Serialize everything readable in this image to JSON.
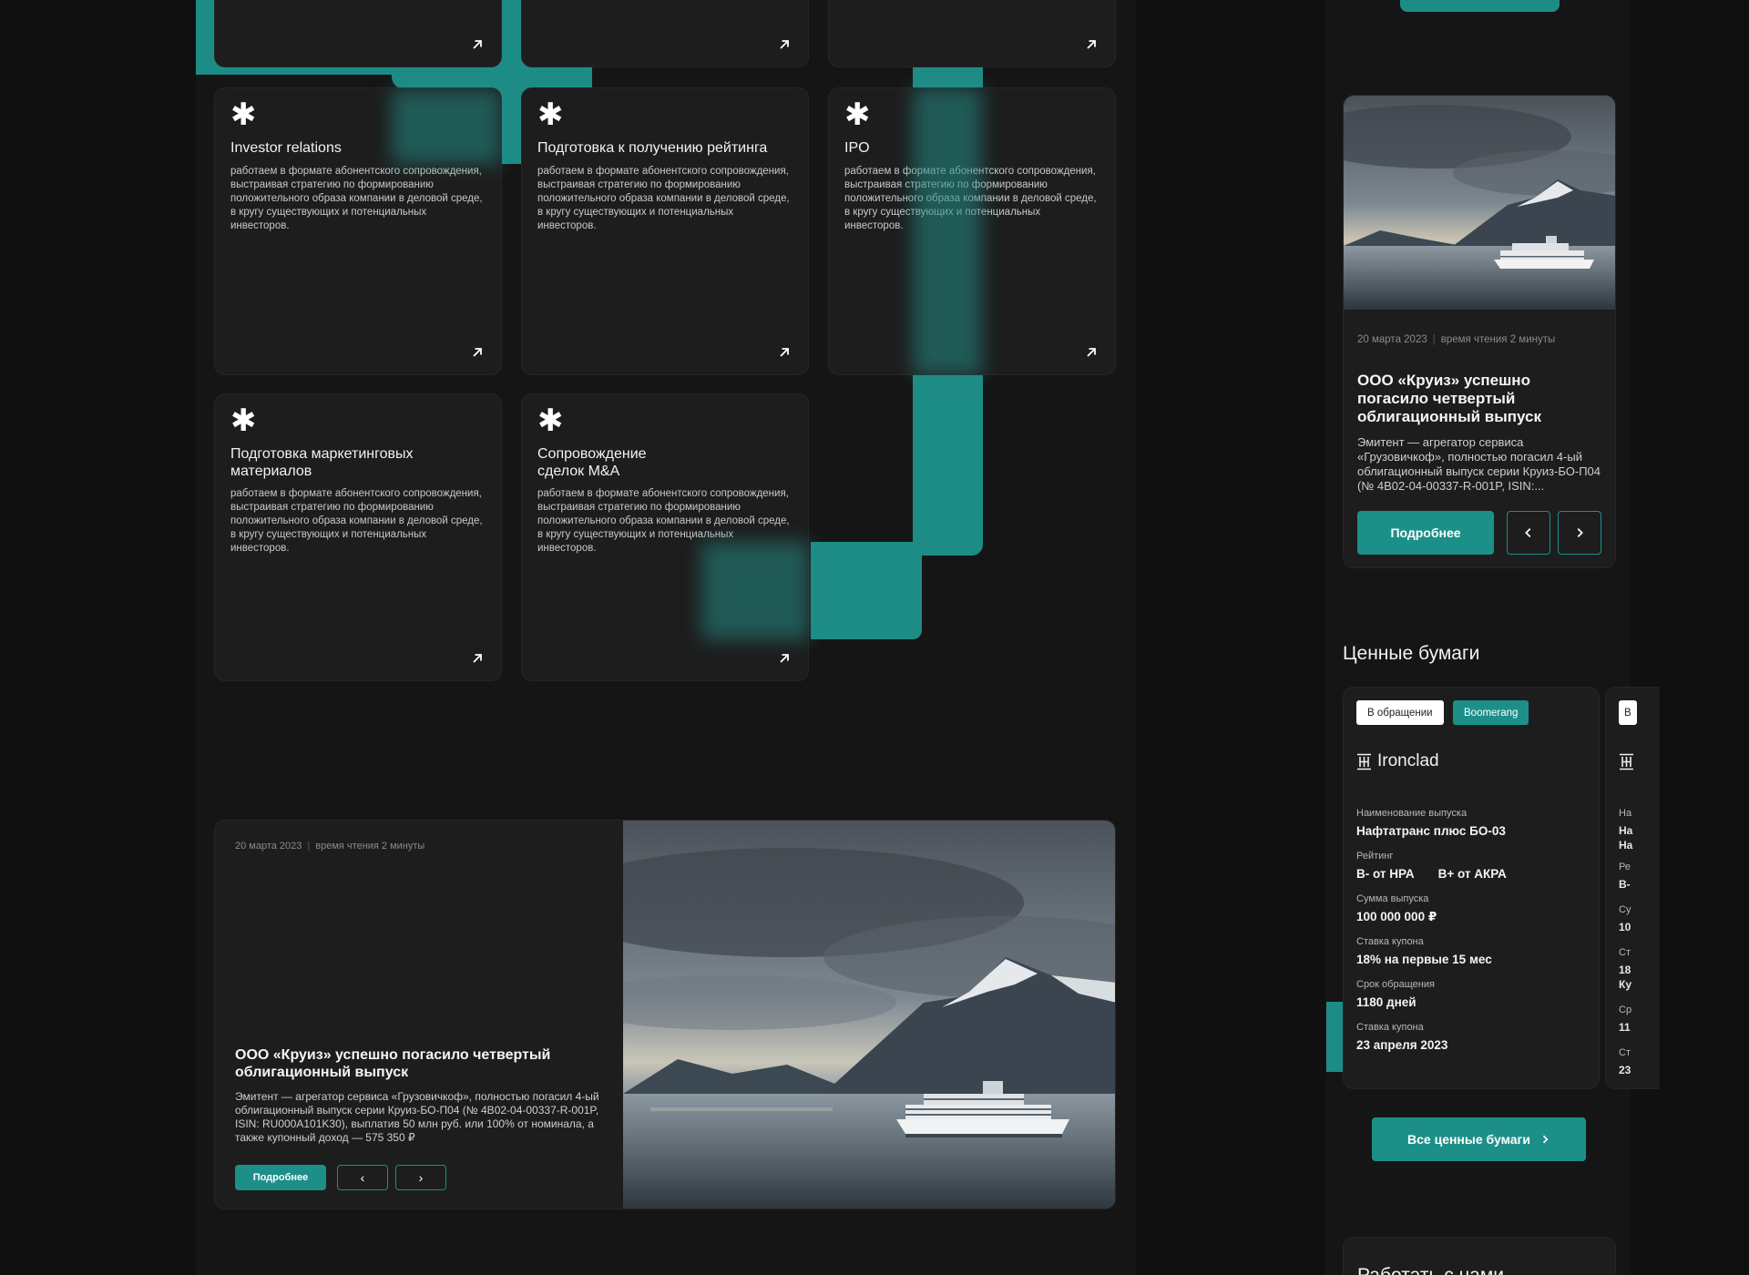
{
  "services": [
    {
      "title": "Investor relations",
      "desc": "работаем в формате абонентского сопровождения, выстраивая стратегию по формированию положительного образа компании в деловой среде, в кругу существующих и потенциальных инвесторов."
    },
    {
      "title": "Подготовка к получению рейтинга",
      "desc": "работаем в формате абонентского сопровождения, выстраивая стратегию по формированию положительного образа компании в деловой среде, в кругу существующих и потенциальных инвесторов."
    },
    {
      "title": "IPO",
      "desc": "работаем в формате абонентского сопровождения, выстраивая стратегию по формированию положительного образа компании в деловой среде, в кругу существующих и потенциальных инвесторов."
    },
    {
      "title": "Подготовка маркетинговых материалов",
      "desc": "работаем в формате абонентского сопровождения, выстраивая стратегию по формированию положительного образа компании в деловой среде, в кругу существующих и потенциальных инвесторов."
    },
    {
      "title": "Сопровождение сделок M&A",
      "desc": "работаем в формате абонентского сопровождения, выстраивая стратегию по формированию положительного образа компании в деловой среде, в кругу существующих и потенциальных инвесторов."
    }
  ],
  "news_wide": {
    "date": "20 марта 2023",
    "read_time": "время чтения 2 минуты",
    "title": "ООО «Круиз» успешно погасило четвертый облигационный выпуск",
    "text": "Эмитент — агрегатор сервиса «Грузовичкоф», полностью погасил 4-ый облигационный выпуск серии Круиз-БО-П04 (№ 4B02-04-00337-R-001P, ISIN: RU000A101K30), выплатив 50 млн руб. или 100% от номинала, а также купонный доход — 575 350 ₽",
    "button": "Подробнее",
    "prev": "‹",
    "next": "›"
  },
  "news_side": {
    "date": "20 марта 2023",
    "read_time": "время чтения 2 минуты",
    "title": "ООО «Круиз» успешно погасило четвертый облигационный выпуск",
    "text": "Эмитент — агрегатор сервиса «Грузовичкоф», полностью погасил 4-ый облигационный выпуск серии Круиз-БО-П04 (№ 4B02-04-00337-R-001P, ISIN:...",
    "button": "Подробнее"
  },
  "securities": {
    "section_title": "Ценные бумаги",
    "tags": [
      "В обращении",
      "Boomerang"
    ],
    "brand": "Ironclad",
    "fields": [
      {
        "label": "Наименование выпуска",
        "value": "Нафтатранс плюс БО-03"
      },
      {
        "label": "Рейтинг",
        "value_a": "B- от НРА",
        "value_b": "B+ от АКРА"
      },
      {
        "label": "Сумма выпуска",
        "value": "100 000 000 ₽"
      },
      {
        "label": "Ставка купона",
        "value": "18% на первые 15 мес"
      },
      {
        "label": "Срок обращения",
        "value": "1180 дней"
      },
      {
        "label": "Ставка купона",
        "value": "23 апреля 2023"
      }
    ],
    "partial_card": {
      "tag": "В",
      "labels": [
        "На",
        "Ре",
        "Су",
        "Ст",
        "Ср",
        "Ст"
      ],
      "values": [
        "На",
        "На",
        "B-",
        "10",
        "18",
        "Ку",
        "11",
        "23"
      ]
    },
    "all_button": "Все ценные бумаги"
  },
  "work_with_us": "Работать с нами",
  "colors": {
    "accent": "#1c8f89",
    "background": "#101010",
    "card": "#1d1d1d"
  }
}
